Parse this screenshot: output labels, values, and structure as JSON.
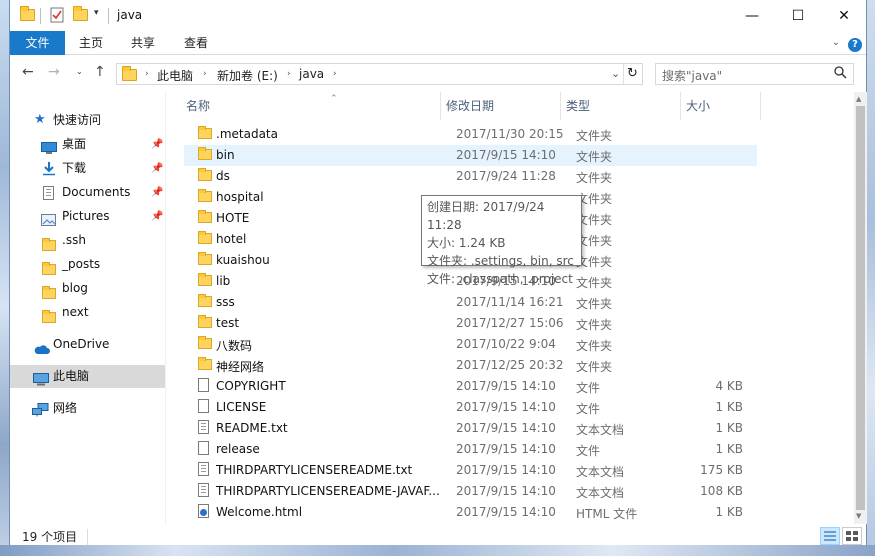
{
  "window": {
    "title": "java",
    "controls": {
      "minimize": "—",
      "maximize": "☐",
      "close": "✕"
    }
  },
  "ribbon": {
    "tabs": [
      {
        "label": "文件",
        "active": true
      },
      {
        "label": "主页"
      },
      {
        "label": "共享"
      },
      {
        "label": "查看"
      }
    ],
    "help": "?"
  },
  "address": {
    "breadcrumbs": [
      "此电脑",
      "新加卷 (E:)",
      "java"
    ],
    "search_placeholder": "搜索\"java\""
  },
  "sidebar": {
    "items": [
      {
        "label": "快速访问",
        "icon": "star-icon"
      },
      {
        "label": "桌面",
        "icon": "desktop-icon",
        "pinned": true
      },
      {
        "label": "下载",
        "icon": "download-icon",
        "pinned": true
      },
      {
        "label": "Documents",
        "icon": "document-icon",
        "pinned": true
      },
      {
        "label": "Pictures",
        "icon": "picture-icon",
        "pinned": true
      },
      {
        "label": ".ssh",
        "icon": "folder-icon"
      },
      {
        "label": "_posts",
        "icon": "folder-icon"
      },
      {
        "label": "blog",
        "icon": "folder-icon"
      },
      {
        "label": "next",
        "icon": "folder-icon"
      },
      {
        "label": "OneDrive",
        "icon": "cloud-icon"
      },
      {
        "label": "此电脑",
        "icon": "computer-icon",
        "selected": true
      },
      {
        "label": "网络",
        "icon": "network-icon"
      }
    ]
  },
  "columns": {
    "name": "名称",
    "date": "修改日期",
    "type": "类型",
    "size": "大小"
  },
  "files": [
    {
      "name": ".metadata",
      "date": "2017/11/30 20:15",
      "type": "文件夹",
      "size": "",
      "icon": "folder-icon"
    },
    {
      "name": "bin",
      "date": "2017/9/15 14:10",
      "type": "文件夹",
      "size": "",
      "icon": "folder-icon",
      "hover": true
    },
    {
      "name": "ds",
      "date": "2017/9/24 11:28",
      "type": "文件夹",
      "size": "",
      "icon": "folder-icon"
    },
    {
      "name": "hospital",
      "date": "",
      "type": "文件夹",
      "size": "",
      "icon": "folder-icon"
    },
    {
      "name": "HOTE",
      "date": "",
      "type": "文件夹",
      "size": "",
      "icon": "folder-icon"
    },
    {
      "name": "hotel",
      "date": "",
      "type": "文件夹",
      "size": "",
      "icon": "folder-icon"
    },
    {
      "name": "kuaishou",
      "date": "",
      "type": "文件夹",
      "size": "",
      "icon": "folder-icon"
    },
    {
      "name": "lib",
      "date": "2017/9/15 14:10",
      "type": "文件夹",
      "size": "",
      "icon": "folder-icon"
    },
    {
      "name": "sss",
      "date": "2017/11/14 16:21",
      "type": "文件夹",
      "size": "",
      "icon": "folder-icon"
    },
    {
      "name": "test",
      "date": "2017/12/27 15:06",
      "type": "文件夹",
      "size": "",
      "icon": "folder-icon"
    },
    {
      "name": "八数码",
      "date": "2017/10/22 9:04",
      "type": "文件夹",
      "size": "",
      "icon": "folder-icon"
    },
    {
      "name": "神经网络",
      "date": "2017/12/25 20:32",
      "type": "文件夹",
      "size": "",
      "icon": "folder-icon"
    },
    {
      "name": "COPYRIGHT",
      "date": "2017/9/15 14:10",
      "type": "文件",
      "size": "4 KB",
      "icon": "file-icon"
    },
    {
      "name": "LICENSE",
      "date": "2017/9/15 14:10",
      "type": "文件",
      "size": "1 KB",
      "icon": "file-icon"
    },
    {
      "name": "README.txt",
      "date": "2017/9/15 14:10",
      "type": "文本文档",
      "size": "1 KB",
      "icon": "text-file-icon"
    },
    {
      "name": "release",
      "date": "2017/9/15 14:10",
      "type": "文件",
      "size": "1 KB",
      "icon": "file-icon"
    },
    {
      "name": "THIRDPARTYLICENSEREADME.txt",
      "date": "2017/9/15 14:10",
      "type": "文本文档",
      "size": "175 KB",
      "icon": "text-file-icon"
    },
    {
      "name": "THIRDPARTYLICENSEREADME-JAVAF...",
      "date": "2017/9/15 14:10",
      "type": "文本文档",
      "size": "108 KB",
      "icon": "text-file-icon"
    },
    {
      "name": "Welcome.html",
      "date": "2017/9/15 14:10",
      "type": "HTML 文件",
      "size": "1 KB",
      "icon": "html-file-icon"
    }
  ],
  "tooltip": {
    "lines": [
      "创建日期: 2017/9/24 11:28",
      "大小: 1.24 KB",
      "文件夹: .settings, bin, src",
      "文件: .classpath, .project"
    ]
  },
  "status": {
    "count": "19 个项目"
  }
}
